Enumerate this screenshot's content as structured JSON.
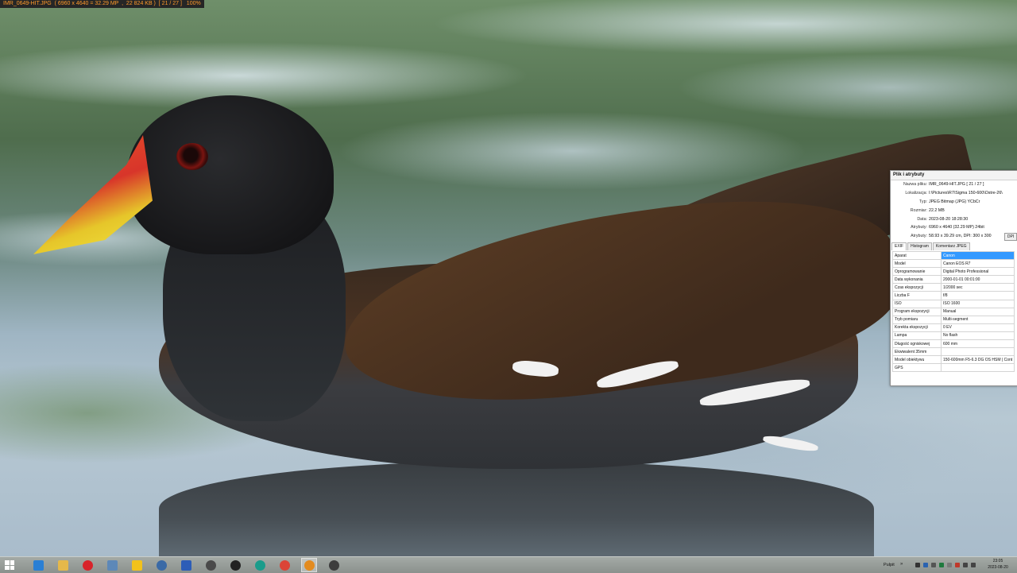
{
  "viewer": {
    "info_line": "IMR_0649-HIT.JPG  ( 6960 x 4640 = 32.29 MP  ,  22 824 KB )  [ 21 / 27 ]   100%"
  },
  "props_panel": {
    "title": "Plik i atrybuty",
    "rows": [
      {
        "key": "Nazwa pliku:",
        "value": "IMR_0649-HIT.JPG  [ 21 / 27 ]"
      },
      {
        "key": "Lokalizacja:",
        "value": "I:\\Pictures\\R7\\Sigma 150-600\\Ostre-26\\"
      },
      {
        "key": "Typ:",
        "value": "JPEG Bitmap (JPG) YCbCr"
      },
      {
        "key": "Rozmiar:",
        "value": "22.2 MB"
      },
      {
        "key": "Data:",
        "value": "2023-08-20 18:28:30"
      },
      {
        "key": "Atrybuty:",
        "value": "6960 x 4640 (32.29 MP)  24bit"
      },
      {
        "key": "Atrybuty:",
        "value": "58.93 x 39.29 cm,  DPI: 300 x 300"
      }
    ],
    "dpi_button": "DPI",
    "tabs": [
      "EXIF",
      "Histogram",
      "Komentarz JPEG"
    ],
    "exif": [
      {
        "key": "Aparat",
        "value": "Canon"
      },
      {
        "key": "Model",
        "value": "Canon EOS R7"
      },
      {
        "key": "Oprogramowanie",
        "value": "Digital Photo Professional"
      },
      {
        "key": "Data wykonania",
        "value": "2000-01-01 00:01:00"
      },
      {
        "key": "Czas ekspozycji",
        "value": "1/2000 sec"
      },
      {
        "key": "Liczba F",
        "value": "f/8"
      },
      {
        "key": "ISO",
        "value": "ISO 1600"
      },
      {
        "key": "Program ekspozycji",
        "value": "Manual"
      },
      {
        "key": "Tryb pomiaru",
        "value": "Multi-segment"
      },
      {
        "key": "Korekta ekspozycji",
        "value": "0 EV"
      },
      {
        "key": "Lampa",
        "value": "No flash"
      },
      {
        "key": "Długość ogniskowej",
        "value": "600 mm"
      },
      {
        "key": "Ekwiwalent 35mm",
        "value": ""
      },
      {
        "key": "Model obiektywu",
        "value": "150-600mm F5-6.3 DG OS HSM | Cont"
      },
      {
        "key": "GPS",
        "value": ""
      }
    ]
  },
  "taskbar": {
    "apps": [
      {
        "name": "start-button",
        "color": "#1e73d8"
      },
      {
        "name": "internet-explorer-icon",
        "color": "#2a7fd4"
      },
      {
        "name": "file-explorer-icon",
        "color": "#e5b84a"
      },
      {
        "name": "opera-icon",
        "color": "#d8232a"
      },
      {
        "name": "notepad-icon",
        "color": "#5d88b8"
      },
      {
        "name": "batman-icon",
        "color": "#f2c21b"
      },
      {
        "name": "network-icon",
        "color": "#3a6aa6"
      },
      {
        "name": "floppy-save-icon",
        "color": "#2d5db7"
      },
      {
        "name": "driver-tool-icon",
        "color": "#4a4a4a"
      },
      {
        "name": "inkscape-icon",
        "color": "#222222"
      },
      {
        "name": "globe-app-icon",
        "color": "#1a9c8b"
      },
      {
        "name": "chrome-icon",
        "color": "#db4437"
      },
      {
        "name": "image-viewer-icon",
        "color": "#e38b1f"
      },
      {
        "name": "tool-app-icon",
        "color": "#3d3d3d"
      }
    ],
    "tray_label": "Pulpit",
    "tray_arrow": "»",
    "clock_time": "23:05",
    "clock_date": "2023-08-20"
  }
}
